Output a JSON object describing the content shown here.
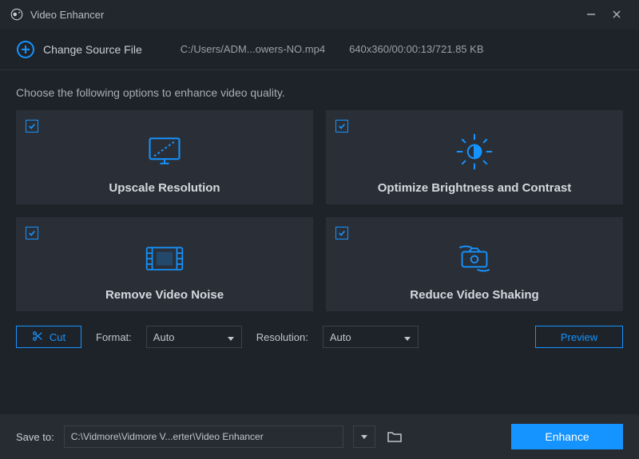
{
  "app": {
    "title": "Video Enhancer"
  },
  "source": {
    "change_label": "Change Source File",
    "path": "C:/Users/ADM...owers-NO.mp4",
    "meta": "640x360/00:00:13/721.85 KB"
  },
  "instruction": "Choose the following options to enhance video quality.",
  "options": [
    {
      "label": "Upscale Resolution"
    },
    {
      "label": "Optimize Brightness and Contrast"
    },
    {
      "label": "Remove Video Noise"
    },
    {
      "label": "Reduce Video Shaking"
    }
  ],
  "controls": {
    "cut_label": "Cut",
    "format_label": "Format:",
    "format_value": "Auto",
    "resolution_label": "Resolution:",
    "resolution_value": "Auto",
    "preview_label": "Preview"
  },
  "footer": {
    "save_label": "Save to:",
    "save_path": "C:\\Vidmore\\Vidmore V...erter\\Video Enhancer",
    "enhance_label": "Enhance"
  }
}
